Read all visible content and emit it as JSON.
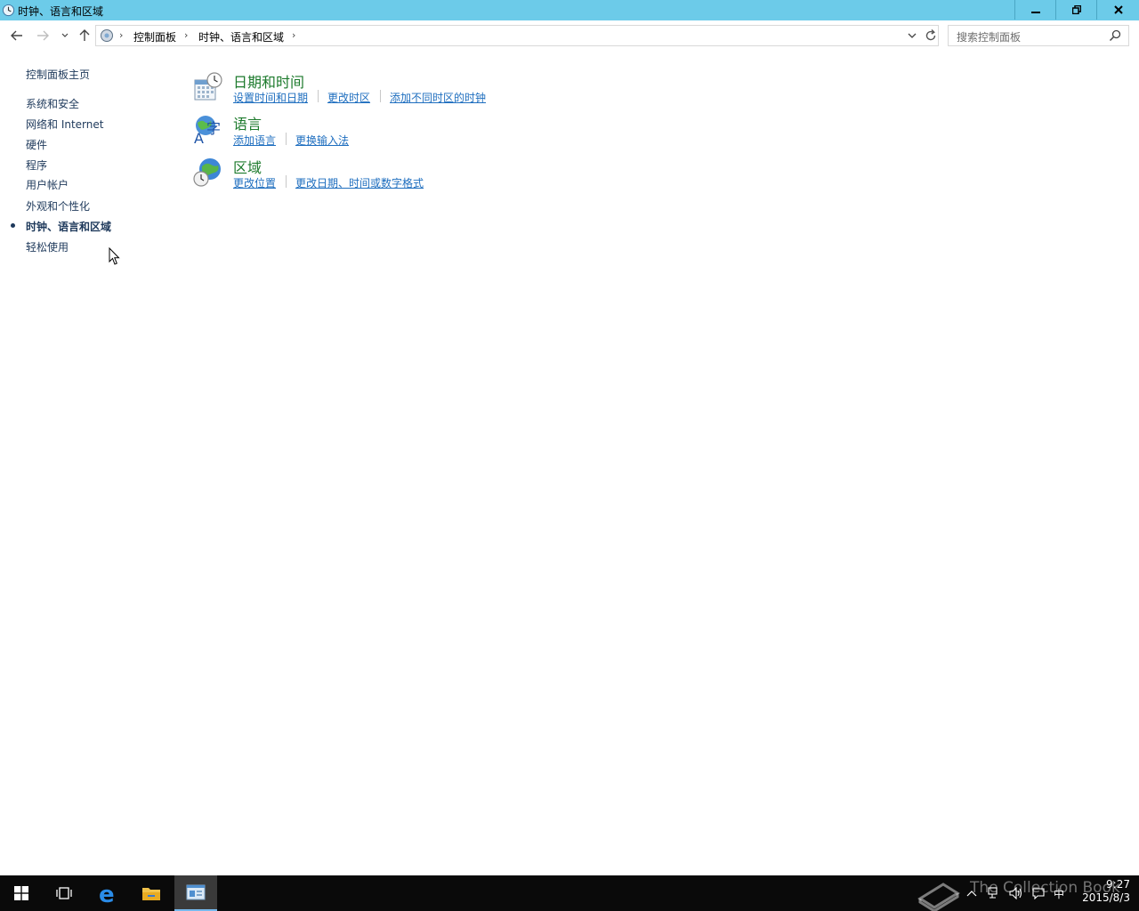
{
  "window": {
    "title": "时钟、语言和区域"
  },
  "address_bar": {
    "crumbs": [
      "控制面板",
      "时钟、语言和区域"
    ],
    "sep": "›"
  },
  "search": {
    "placeholder": "搜索控制面板"
  },
  "left_nav": {
    "home": "控制面板主页",
    "items": [
      {
        "label": "系统和安全"
      },
      {
        "label": "网络和 Internet"
      },
      {
        "label": "硬件"
      },
      {
        "label": "程序"
      },
      {
        "label": "用户帐户"
      },
      {
        "label": "外观和个性化"
      },
      {
        "label": "时钟、语言和区域",
        "active": true
      },
      {
        "label": "轻松使用"
      }
    ]
  },
  "categories": [
    {
      "title": "日期和时间",
      "icon": "calendar-clock-icon",
      "links": [
        "设置时间和日期",
        "更改时区",
        "添加不同时区的时钟"
      ]
    },
    {
      "title": "语言",
      "icon": "language-globe-icon",
      "links": [
        "添加语言",
        "更换输入法"
      ]
    },
    {
      "title": "区域",
      "icon": "region-globe-icon",
      "links": [
        "更改位置",
        "更改日期、时间或数字格式"
      ]
    }
  ],
  "taskbar": {
    "clock_time": "9:27",
    "clock_date": "2015/8/3",
    "ime": "中",
    "watermark": "The Collection Book"
  },
  "colors": {
    "titlebar": "#6ccbe9",
    "category_title": "#1c7a2c",
    "link": "#1e6ebf",
    "taskbar": "#0a0a0a"
  }
}
